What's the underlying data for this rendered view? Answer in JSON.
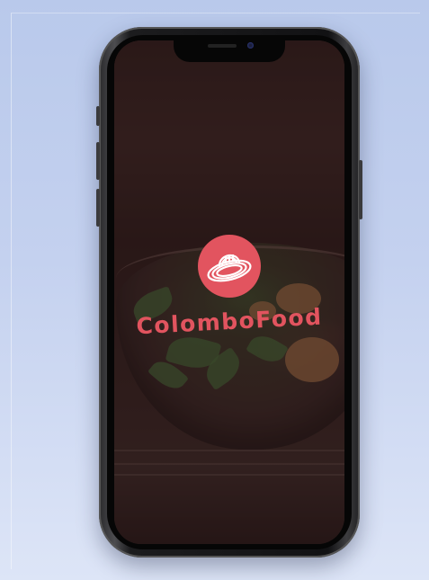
{
  "app": {
    "brand_name": "ColomboFood",
    "logo_icon": "sombrero-vueltiao-icon"
  },
  "colors": {
    "brand": "#e2545f",
    "background_top": "#b9c9eb",
    "background_bottom": "#dde5f7",
    "phone_body": "#121214",
    "screen_overlay": "#281414"
  }
}
